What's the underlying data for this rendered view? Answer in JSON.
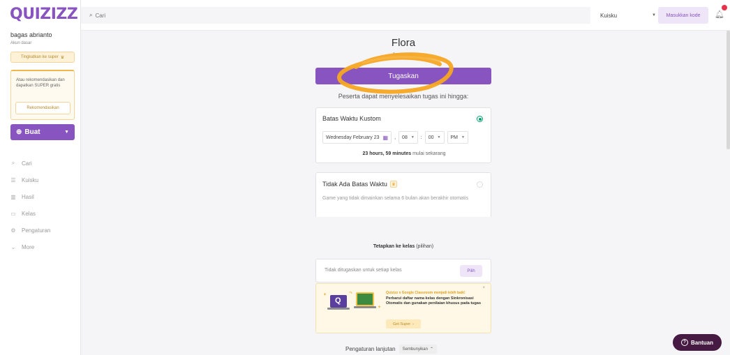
{
  "app": {
    "logo": "QUIZIZZ"
  },
  "sidebar": {
    "username": "bagas abrianto",
    "account_type": "Akun dasar",
    "upgrade_label": "Tingkatkan ke super",
    "reco_text": "Atau rekomendasikan dan dapatkan SUPER gratis",
    "reco_button": "Rekomendasikan",
    "create_label": "Buat",
    "nav": [
      {
        "label": "Cari",
        "icon": "search-icon"
      },
      {
        "label": "Kuisku",
        "icon": "list-icon"
      },
      {
        "label": "Hasil",
        "icon": "chart-icon"
      },
      {
        "label": "Kelas",
        "icon": "class-icon"
      },
      {
        "label": "Pengaturan",
        "icon": "gear-icon"
      },
      {
        "label": "More",
        "icon": "chevron-down-icon"
      }
    ]
  },
  "topbar": {
    "search_placeholder": "Cari",
    "filter_value": "Kuisku",
    "code_button": "Masukkan kode"
  },
  "main": {
    "quiz_title": "Flora",
    "quiz_sub": "Pertanyaan",
    "assign_button": "Tugaskan",
    "deadline_text": "Peserta dapat menyelesaikan tugas ini hingga:",
    "custom_deadline": {
      "title": "Batas Waktu Kustom",
      "date": "Wednesday February 23",
      "hour": "08",
      "minute": "00",
      "ampm": "PM",
      "remaining_bold": "23 hours, 59 minutes",
      "remaining_rest": "mulai sekarang"
    },
    "no_deadline": {
      "title": "Tidak Ada Batas Waktu",
      "desc": "Game yang tidak dimainkan selama 6 bulan akan berakhir otomatis"
    },
    "class_label_bold": "Tetapkan ke kelas",
    "class_label_rest": "(pilihan)",
    "class_text": "Tidak ditugaskan untuk setiap kelas",
    "pick_button": "Pilih",
    "promo": {
      "head": "Quizizz x Google Classroom menjadi lebih baik!",
      "body": "Perbarui daftar nama kelas dengan Sinkronisasi Otomatis dan gunakan penilaian khusus pada tugas",
      "button": "Get Super"
    },
    "advanced_label": "Pengaturan lanjutan",
    "hide_button": "Sembunyikan"
  },
  "help_button": "Bantuan",
  "colors": {
    "brand": "#8854c0",
    "annotation": "#f5a623",
    "selected": "#00a06a"
  }
}
